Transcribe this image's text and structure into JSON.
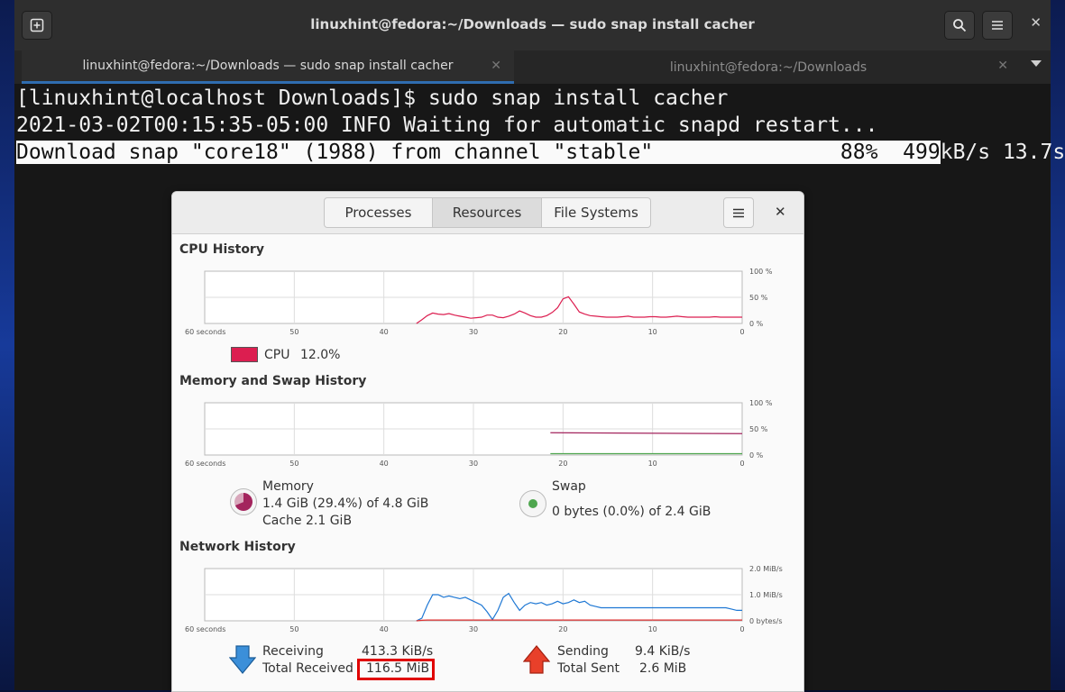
{
  "window": {
    "title": "linuxhint@fedora:~/Downloads — sudo snap install cacher"
  },
  "tabs": [
    {
      "label": "linuxhint@fedora:~/Downloads — sudo snap install cacher"
    },
    {
      "label": "linuxhint@fedora:~/Downloads"
    }
  ],
  "terminal": {
    "line1": "[linuxhint@localhost Downloads]$ sudo snap install cacher",
    "line2": "2021-03-02T00:15:35-05:00 INFO Waiting for automatic snapd restart...",
    "line3_a": "Download snap \"",
    "line3_b": "core18",
    "line3_c": "\" (1988) from channel \"stable\"               88%  499",
    "line3_d": "kB/s 13.7s"
  },
  "system_monitor": {
    "tabs": [
      "Processes",
      "Resources",
      "File Systems"
    ],
    "selected_tab": "Resources",
    "x_ticks": [
      "60 seconds",
      "50",
      "40",
      "30",
      "20",
      "10",
      "0"
    ],
    "cpu": {
      "title": "CPU History",
      "y_ticks": [
        "100 %",
        "50 %",
        "0 %"
      ],
      "label": "CPU",
      "value": "12.0%",
      "color": "#dc1e50",
      "series": [
        0,
        0,
        0,
        0,
        0,
        0,
        0,
        0,
        0,
        0,
        0,
        0,
        0,
        0,
        0,
        0,
        0,
        0,
        0,
        0,
        0,
        0,
        0,
        0,
        0,
        0,
        0,
        0,
        0,
        0,
        0,
        0,
        0,
        0,
        0,
        0,
        0,
        0,
        0,
        0,
        7,
        15,
        20,
        18,
        17,
        19,
        16,
        14,
        12,
        10,
        11,
        12,
        16,
        16,
        12,
        11,
        14,
        18,
        24,
        20,
        15,
        12,
        12,
        15,
        21,
        30,
        47,
        51,
        37,
        22,
        18,
        15,
        14,
        13,
        12,
        12,
        12,
        13,
        14,
        12,
        12,
        12,
        13,
        13,
        12,
        12,
        13,
        14,
        13,
        12,
        12,
        12,
        12,
        12,
        13,
        12,
        12,
        12,
        12,
        12
      ]
    },
    "memory": {
      "title": "Memory and Swap History",
      "y_ticks": [
        "100 %",
        "50 %",
        "0 %"
      ],
      "memory_label": "Memory",
      "memory_used": "1.4 GiB (29.4%) of 4.8 GiB",
      "memory_cache": "Cache 2.1 GiB",
      "swap_label": "Swap",
      "swap_used": "0 bytes (0.0%) of 2.4 GiB",
      "memory_percent": 29.4,
      "swap_percent": 0.0,
      "memory_color": "#a3245d",
      "swap_color": "#4ea64e"
    },
    "network": {
      "title": "Network History",
      "y_ticks": [
        "2.0 MiB/s",
        "1.0 MiB/s",
        "0 bytes/s"
      ],
      "receiving_label": "Receiving",
      "receiving_value": "413.3 KiB/s",
      "total_received_label": "Total Received",
      "total_received_value": "116.5 MiB",
      "sending_label": "Sending",
      "sending_value": "9.4 KiB/s",
      "total_sent_label": "Total Sent",
      "total_sent_value": "2.6 MiB",
      "receiving_color": "#1f78d4",
      "sending_color": "#e03030",
      "recv_series": [
        0,
        0,
        0,
        0,
        0,
        0,
        0,
        0,
        0,
        0,
        0,
        0,
        0,
        0,
        0,
        0,
        0,
        0,
        0,
        0,
        0,
        0,
        0,
        0,
        0,
        0,
        0,
        0,
        0,
        0,
        0,
        0,
        0,
        0,
        0,
        0,
        0,
        0,
        0,
        0,
        0.1,
        0.6,
        1.0,
        1.0,
        0.9,
        0.95,
        0.9,
        0.85,
        0.9,
        0.8,
        0.7,
        0.6,
        0.35,
        0.05,
        0.4,
        0.9,
        1.05,
        0.7,
        0.4,
        0.6,
        0.7,
        0.65,
        0.7,
        0.6,
        0.65,
        0.75,
        0.65,
        0.7,
        0.8,
        0.7,
        0.75,
        0.6,
        0.55,
        0.5,
        0.5,
        0.5,
        0.5,
        0.5,
        0.5,
        0.5,
        0.5,
        0.5,
        0.5,
        0.5,
        0.5,
        0.5,
        0.5,
        0.5,
        0.5,
        0.5,
        0.5,
        0.5,
        0.5,
        0.5,
        0.5,
        0.5,
        0.5,
        0.45,
        0.4,
        0.4
      ],
      "send_series": [
        0,
        0,
        0,
        0,
        0,
        0,
        0,
        0,
        0,
        0,
        0,
        0,
        0,
        0,
        0,
        0,
        0,
        0,
        0,
        0,
        0,
        0,
        0,
        0,
        0,
        0,
        0,
        0,
        0,
        0,
        0,
        0,
        0,
        0,
        0,
        0,
        0,
        0,
        0,
        0,
        0.02,
        0.03,
        0.03,
        0.03,
        0.03,
        0.03,
        0.03,
        0.03,
        0.03,
        0.03,
        0.03,
        0.03,
        0.03,
        0.03,
        0.03,
        0.03,
        0.03,
        0.03,
        0.03,
        0.03,
        0.03,
        0.03,
        0.03,
        0.03,
        0.03,
        0.03,
        0.03,
        0.03,
        0.03,
        0.03,
        0.03,
        0.03,
        0.03,
        0.03,
        0.03,
        0.03,
        0.03,
        0.03,
        0.03,
        0.03,
        0.03,
        0.03,
        0.03,
        0.03,
        0.03,
        0.03,
        0.03,
        0.03,
        0.03,
        0.03,
        0.03,
        0.03,
        0.03,
        0.03,
        0.03,
        0.03,
        0.03,
        0.03,
        0.03,
        0.03
      ]
    }
  }
}
